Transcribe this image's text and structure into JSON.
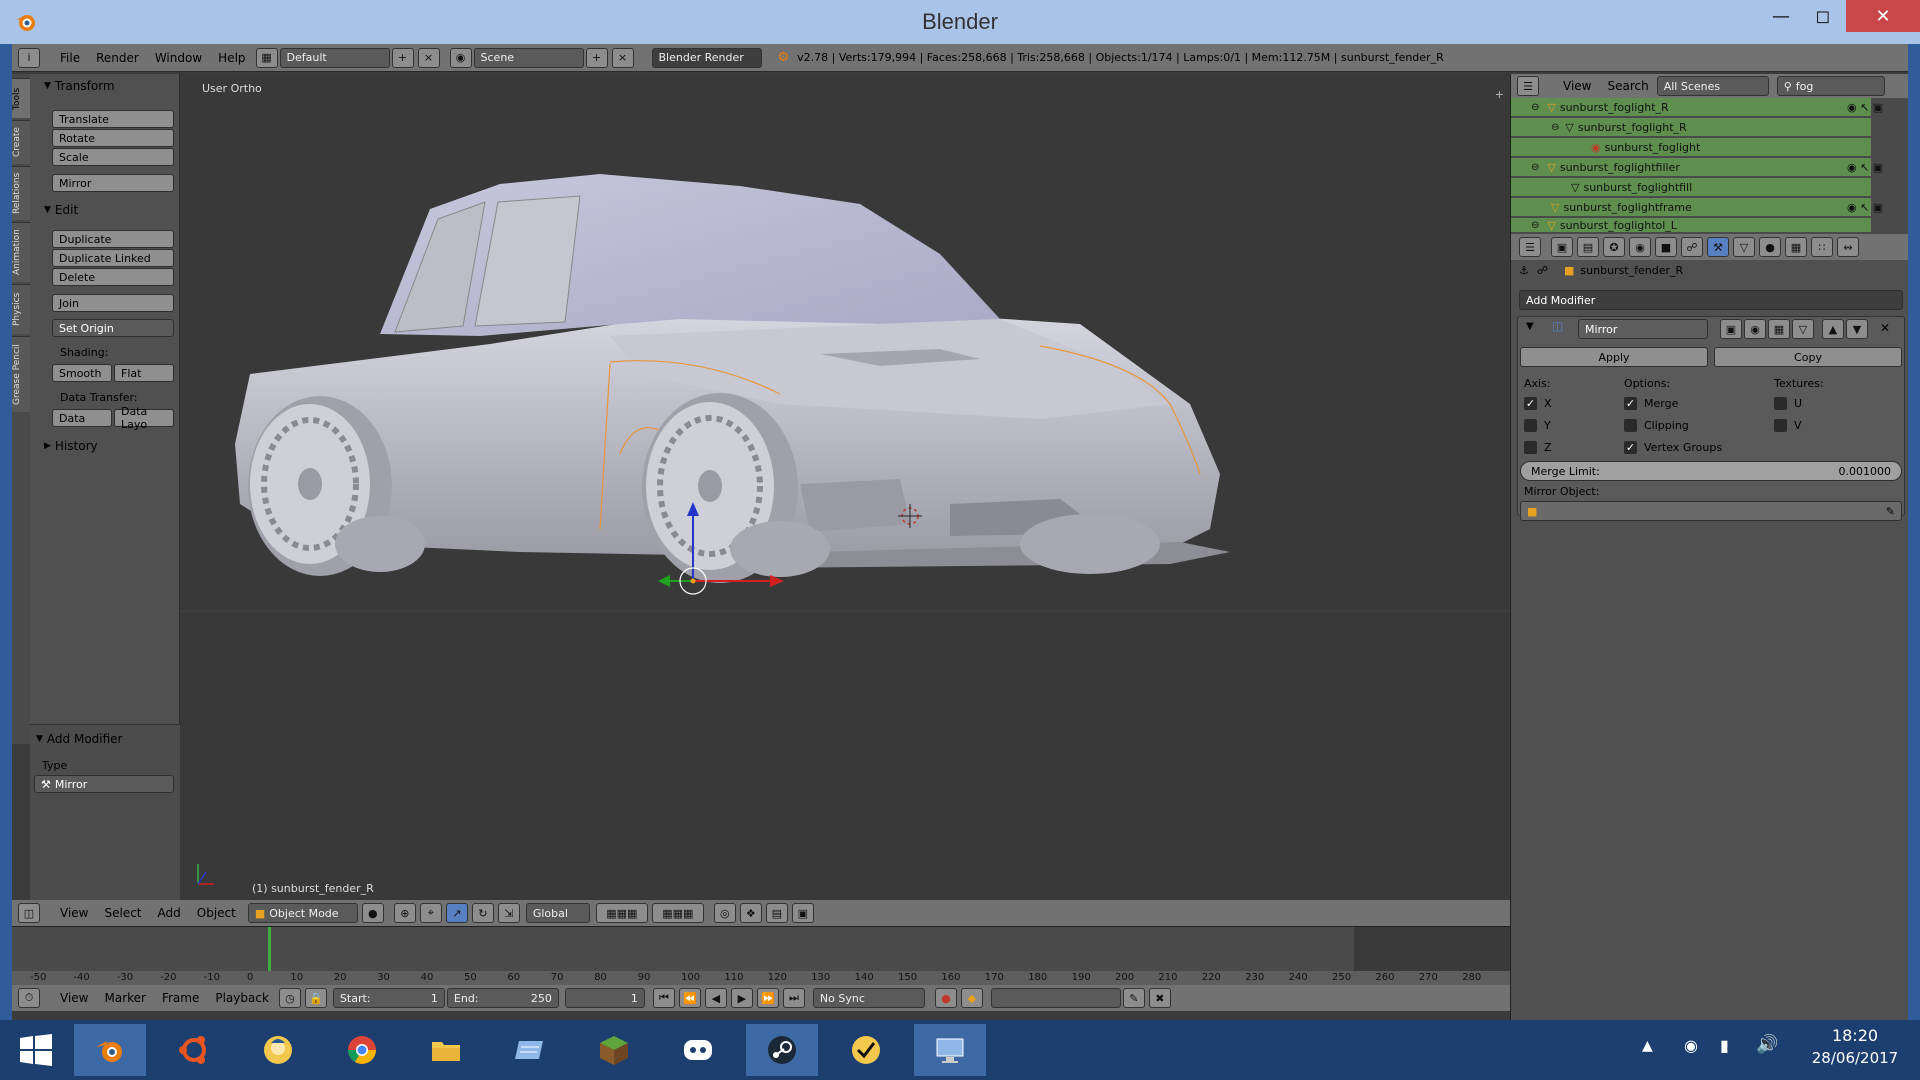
{
  "window": {
    "title": "Blender"
  },
  "info_header": {
    "menus": [
      "File",
      "Render",
      "Window",
      "Help"
    ],
    "layout": "Default",
    "scene": "Scene",
    "engine": "Blender Render",
    "stats": "v2.78 | Verts:179,994 | Faces:258,668 | Tris:258,668 | Objects:1/174 | Lamps:0/1 | Mem:112.75M | sunburst_fender_R"
  },
  "tool_tabs": [
    "Tools",
    "Create",
    "Relations",
    "Animation",
    "Physics",
    "Grease Pencil"
  ],
  "toolshelf": {
    "transform_title": "Transform",
    "translate": "Translate",
    "rotate": "Rotate",
    "scale": "Scale",
    "mirror": "Mirror",
    "edit_title": "Edit",
    "duplicate": "Duplicate",
    "duplicate_linked": "Duplicate Linked",
    "delete": "Delete",
    "join": "Join",
    "set_origin": "Set Origin",
    "shading_label": "Shading:",
    "smooth": "Smooth",
    "flat": "Flat",
    "data_transfer_label": "Data Transfer:",
    "data": "Data",
    "data_layo": "Data Layo",
    "history_title": "History",
    "add_modifier_title": "Add Modifier",
    "type_label": "Type",
    "type_value": "Mirror"
  },
  "viewport": {
    "view_label": "User Ortho",
    "object_label": "(1) sunburst_fender_R"
  },
  "viewport_header": {
    "menus": [
      "View",
      "Select",
      "Add",
      "Object"
    ],
    "mode": "Object Mode",
    "orientation": "Global"
  },
  "timeline": {
    "ticks": [
      "-50",
      "-40",
      "-30",
      "-20",
      "-10",
      "0",
      "10",
      "20",
      "30",
      "40",
      "50",
      "60",
      "70",
      "80",
      "90",
      "100",
      "110",
      "120",
      "130",
      "140",
      "150",
      "160",
      "170",
      "180",
      "190",
      "200",
      "210",
      "220",
      "230",
      "240",
      "250",
      "260",
      "270",
      "280"
    ],
    "menus": [
      "View",
      "Marker",
      "Frame",
      "Playback"
    ],
    "start_label": "Start:",
    "start_value": "1",
    "end_label": "End:",
    "end_value": "250",
    "current_frame": "1",
    "sync": "No Sync"
  },
  "outliner": {
    "menus": [
      "View",
      "Search"
    ],
    "scenes": "All Scenes",
    "search": "fog",
    "rows": [
      {
        "label": "sunburst_foglight_R",
        "indent": 0
      },
      {
        "label": "sunburst_foglight_R",
        "indent": 1
      },
      {
        "label": "sunburst_foglight",
        "indent": 2
      },
      {
        "label": "sunburst_foglightfiller",
        "indent": 0
      },
      {
        "label": "sunburst_foglightfill",
        "indent": 1
      },
      {
        "label": "sunburst_foglightframe",
        "indent": 0
      },
      {
        "label": "sunburst_foglightol_L",
        "indent": 0
      }
    ]
  },
  "properties": {
    "object_name": "sunburst_fender_R",
    "add_modifier": "Add Modifier",
    "modifier_name": "Mirror",
    "apply": "Apply",
    "copy": "Copy",
    "axis_label": "Axis:",
    "options_label": "Options:",
    "textures_label": "Textures:",
    "axis_x": "X",
    "axis_y": "Y",
    "axis_z": "Z",
    "merge": "Merge",
    "clipping": "Clipping",
    "vertex_groups": "Vertex Groups",
    "tex_u": "U",
    "tex_v": "V",
    "merge_limit_label": "Merge Limit:",
    "merge_limit_value": "0.001000",
    "mirror_object_label": "Mirror Object:",
    "checks": {
      "x": true,
      "y": false,
      "z": false,
      "merge": true,
      "clipping": false,
      "vertex_groups": true,
      "u": false,
      "v": false
    }
  },
  "taskbar": {
    "time": "18:20",
    "date": "28/06/2017"
  },
  "colors": {
    "selected_outline": "#e8953a",
    "outliner_highlight": "#5e8f4e",
    "accent_blue": "#5680c2"
  }
}
